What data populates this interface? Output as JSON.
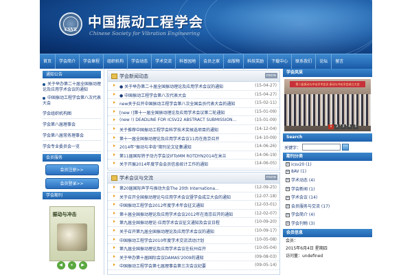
{
  "header": {
    "title": "中国振动工程学会",
    "subtitle": "Chinese Society for Vibration Engineering",
    "logo_text": "CSVE"
  },
  "nav": [
    "首页",
    "学会简介",
    "学会章程",
    "组织机构",
    "学会动态",
    "学术交流",
    "科普园地",
    "会员之家",
    "出版物",
    "科技奖励",
    "下载中心",
    "联系我们",
    "论坛",
    "留言"
  ],
  "left": {
    "notice_title": "通知公告",
    "notices": [
      "关于举办第二十届全国振动理论及应用学术会议的通知",
      "中国振动工程学会第八次代表大会"
    ],
    "links": [
      "学会组织机构图",
      "学会第八届理事会",
      "学会第八届常务理事会",
      "学会专业委员会一览"
    ],
    "service_title": "会员服务",
    "buttons": [
      "会员注册>>",
      "会员登录>>"
    ],
    "journal_title": "学会期刊",
    "journal_name": "振动与冲击",
    "player": [
      "◀",
      "⏸",
      "▶"
    ]
  },
  "news": {
    "title": "学会新闻动态",
    "more": "more",
    "items": [
      {
        "text": "● 关于举办第二十届全国振动理论及应用学术会议的通知",
        "date": "(15-04-27)"
      },
      {
        "text": "● 中国振动工程学会第八次代表大会",
        "date": "(15-04-27)"
      },
      {
        "text": "new关于召开中国振动工程学会第八次全国会员代表大会的通知",
        "date": "(15-02-11)"
      },
      {
        "text": "[new !]第十一届全国振动理论及应用学术会议第二轮通知",
        "date": "(15-01-09)"
      },
      {
        "text": "(new !) DEADLINE FOR ICSV22 ABSTRACT SUBMISSION...",
        "date": "(15-01-09)"
      },
      {
        "text": "关于推荐中国振动工程学会科学技术奖候选项目的通知",
        "date": "(14-12-04)"
      },
      {
        "text": "第十一届全国振动理论及应用学术会议11月在南京召开",
        "date": "(14-10-09)"
      },
      {
        "text": "2014年\"振动与冲击\"期刊论文征集通知",
        "date": "(14-06-26)"
      },
      {
        "text": "第11届国际转子动力学会议IFToMM ROTDYN2014在米兰",
        "date": "(14-06-19)"
      },
      {
        "text": "关于开展2014年度学会会员信息统计工作的通知",
        "date": "(14-06-05)"
      }
    ]
  },
  "academic": {
    "title": "学术会议与交流",
    "more": "more",
    "items": [
      {
        "text": "第20届国际声学与振动大会The 20th Internationa...",
        "date": "(12-09-25)"
      },
      {
        "text": "关于召开全国振动理论与应用学术会议暨学会成立大会的通知",
        "date": "(12-07-18)"
      },
      {
        "text": "中国振动工程学会2012年度学术年会征文通知",
        "date": "(12-03-01)"
      },
      {
        "text": "第十届全国振动理论及应用学术会议2012年在南京召开的通知",
        "date": "(12-02-07)"
      },
      {
        "text": "第九届全国振动理论·应用学术会议征文通知及会议日程",
        "date": "(10-09-20)"
      },
      {
        "text": "关于召开第九届全国振动理论及应用学术会议的通知",
        "date": "(10-09-17)"
      },
      {
        "text": "中国振动工程学会2010年度学术交流活动计划",
        "date": "(10-05-08)"
      },
      {
        "text": "第九届全国振动理论及应用学术会议在杭州召开",
        "date": "(10-05-04)"
      },
      {
        "text": "关于举办第十届国际会议DAMAS'2009的通知",
        "date": "(09-08-03)"
      },
      {
        "text": "中国振动工程学会第七届理事会第三次会议纪要",
        "date": "(09-05-14)"
      }
    ]
  },
  "right": {
    "photo_title": "学会风采",
    "photo_banner": "第二届振动与冲击学术会议 振动与冲击学会成立大会",
    "slides": [
      "1",
      "2",
      "3",
      "4",
      "5"
    ],
    "search_title": "Search",
    "search_label": "关键字：",
    "cat_title": "期刊分类",
    "categories": [
      "icsv20 (1)",
      "8AV (1)",
      "学术动态 (4)",
      "学会新闻 (1)",
      "学术会议 (14)",
      "会员服务与交流 (17)",
      "学会简介 (4)",
      "学会刊物 (3)"
    ],
    "info_title": "会员信息",
    "info_lines": [
      "会员：",
      "2015年6月4日 星期四",
      "访问量：undefined"
    ]
  }
}
